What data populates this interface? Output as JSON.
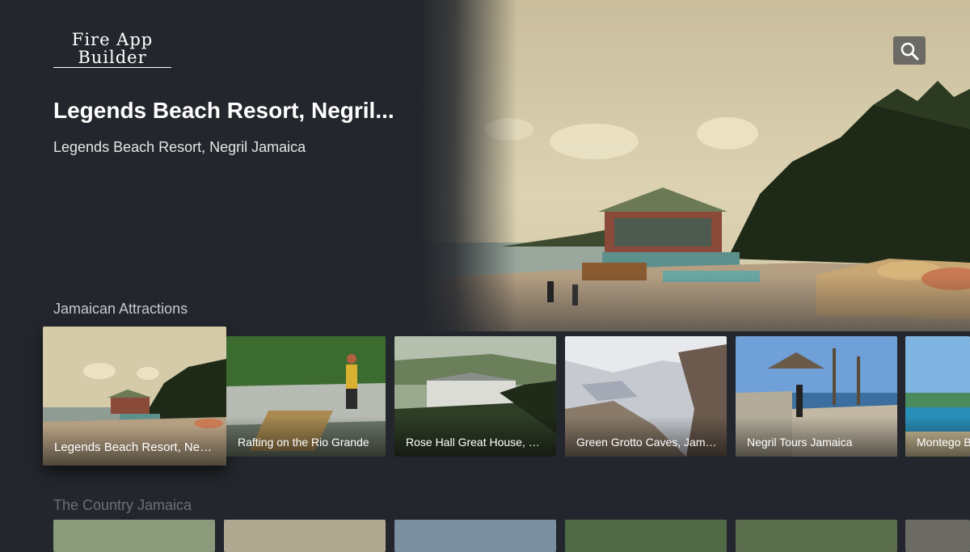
{
  "app": {
    "logo_line1": "Fire App",
    "logo_line2": "Builder"
  },
  "header": {
    "search_icon": "search-icon"
  },
  "featured": {
    "title": "Legends Beach Resort, Negril...",
    "description": "Legends Beach Resort, Negril Jamaica"
  },
  "rows": [
    {
      "label": "Jamaican Attractions",
      "items": [
        {
          "caption": "Legends Beach Resort, Negril Jamaica"
        },
        {
          "caption": "Rafting on the Rio Grande"
        },
        {
          "caption": "Rose Hall Great House, Montego Bay"
        },
        {
          "caption": "Green Grotto Caves, Jamaica"
        },
        {
          "caption": "Negril Tours Jamaica"
        },
        {
          "caption": "Montego Bay"
        }
      ]
    },
    {
      "label": "The Country Jamaica"
    }
  ],
  "colors": {
    "background": "#23262c",
    "search_button": "#5a5a5a"
  }
}
